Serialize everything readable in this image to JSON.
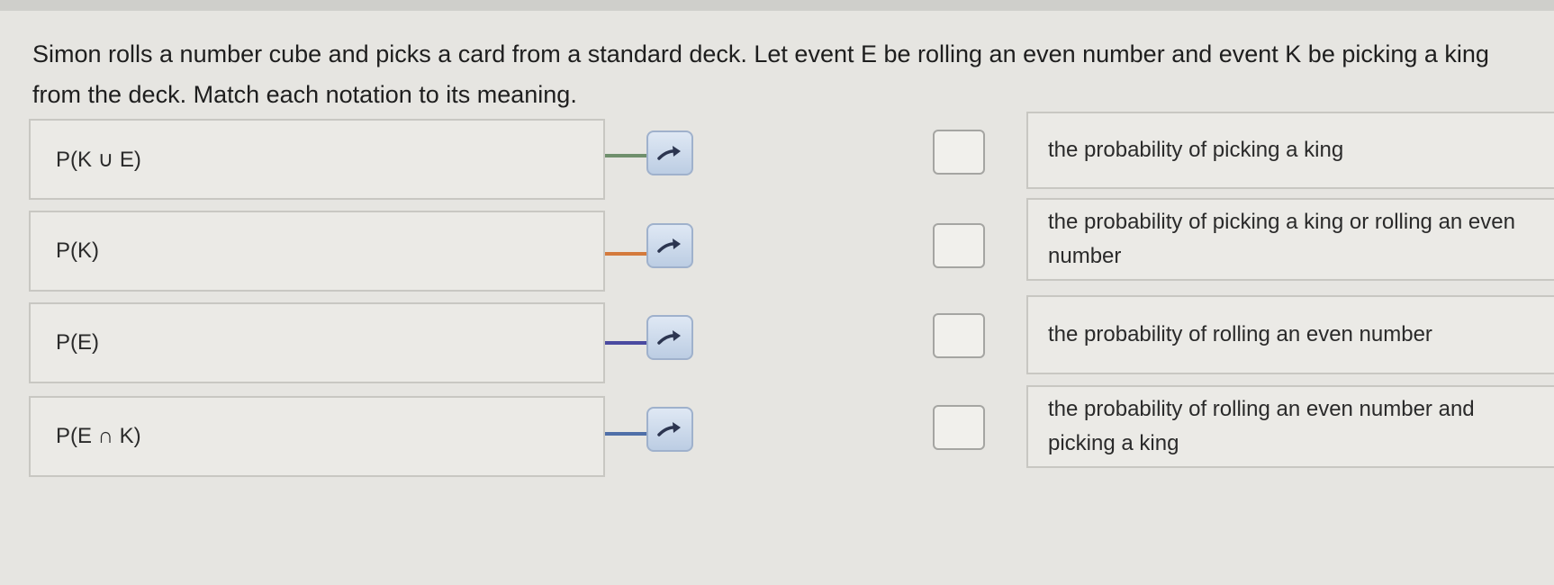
{
  "question": "Simon rolls a number cube and picks a card from a standard deck. Let event E be rolling an even number and event K be picking a king from the deck. Match each notation to its meaning.",
  "notations": [
    {
      "label": "P(K ∪ E)",
      "connector_color": "#6f8f6c"
    },
    {
      "label": "P(K)",
      "connector_color": "#d47a3c"
    },
    {
      "label": "P(E)",
      "connector_color": "#4a4aa0"
    },
    {
      "label": "P(E ∩ K)",
      "connector_color": "#4f6fa8"
    }
  ],
  "meanings": [
    {
      "label": "the probability of picking a king"
    },
    {
      "label": "the probability of picking a king or rolling an even number"
    },
    {
      "label": "the probability of rolling an even number"
    },
    {
      "label": "the probability of rolling an even number and picking a king"
    }
  ],
  "icons": {
    "arrow": "arrow-right-icon",
    "checkbox": "empty-checkbox"
  },
  "colors": {
    "arrow_button": "#bccde3",
    "arrow_glyph": "#2c3550"
  }
}
